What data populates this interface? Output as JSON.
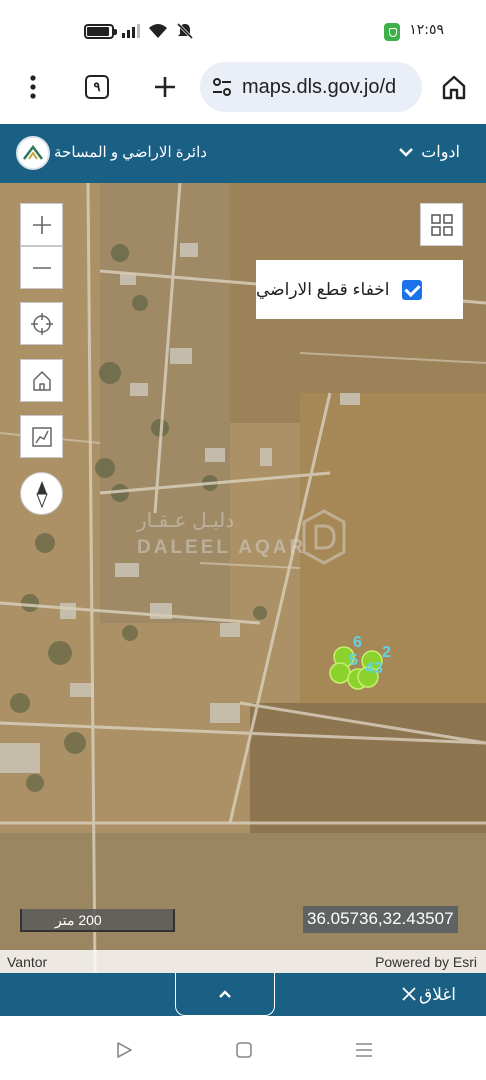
{
  "status_bar": {
    "time": "١٢:٥٩"
  },
  "browser": {
    "url": "maps.dls.gov.jo/d",
    "tab_count": "٩",
    "icons": [
      "more-vert-icon",
      "tabs-icon",
      "plus-icon",
      "site-settings-icon",
      "home-icon"
    ]
  },
  "header": {
    "title": "دائرة الاراضي و المساحة",
    "tools_label": "ادوات"
  },
  "map": {
    "hide_parcels_label": "اخفاء قطع الاراضي",
    "hide_parcels_checked": true,
    "watermark_ar": "دليـل عـقـار",
    "watermark_en": "DALEEL AQAR",
    "scale_label": "200 متر",
    "coordinates": "36.05736,32.43507",
    "attribution_left": "Vantor",
    "attribution_right": "Powered by Esri",
    "marker_labels": [
      "6",
      "2",
      "5",
      "4",
      "3"
    ],
    "marker_color": "#8cd22c",
    "controls": [
      "zoom-in-icon",
      "zoom-out-icon",
      "locate-icon",
      "home-extent-icon",
      "measure-icon",
      "compass-icon",
      "basemap-grid-icon"
    ]
  },
  "bottom": {
    "close_label": "اغلاق"
  },
  "colors": {
    "brand": "#1a5f84",
    "checkbox": "#1a73e8"
  }
}
